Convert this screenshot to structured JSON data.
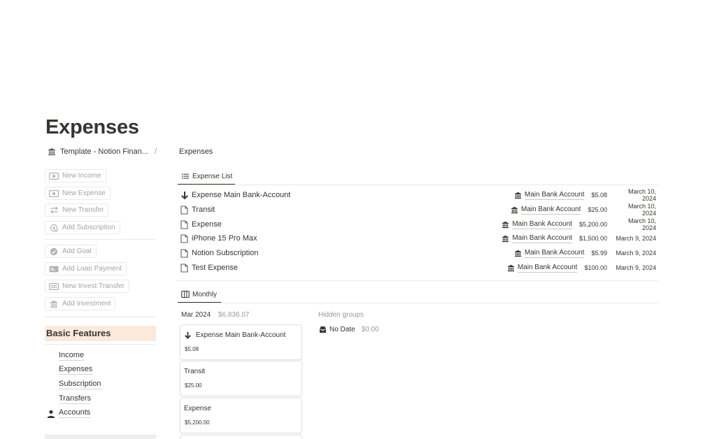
{
  "page": {
    "title": "Expenses"
  },
  "breadcrumb": {
    "parent": "Template - Notion Finan...",
    "separator": "/",
    "current": "Expenses"
  },
  "left_buttons": {
    "group1": [
      "New Income",
      "New Expense",
      "New Transfer",
      "Add Subscription"
    ],
    "group2": [
      "Add Goal",
      "Add Loan Payment",
      "New Invest Transfer",
      "Add Investment"
    ]
  },
  "basic_features": {
    "heading": "Basic Features",
    "links": [
      "Income",
      "Expenses",
      "Subscription",
      "Transfers",
      "Accounts"
    ]
  },
  "list_view": {
    "tab_label": "Expense List",
    "rows": [
      {
        "name": "Expense Main Bank-Account",
        "icon": "arrow-down-icon",
        "account": "Main Bank Account",
        "amount": "$5.08",
        "date": "March 10, 2024"
      },
      {
        "name": "Transit",
        "icon": "page-icon",
        "account": "Main Bank Account",
        "amount": "$25.00",
        "date": "March 10, 2024"
      },
      {
        "name": "Expense",
        "icon": "page-icon",
        "account": "Main Bank Account",
        "amount": "$5,200.00",
        "date": "March 10, 2024"
      },
      {
        "name": "iPhone 15 Pro Max",
        "icon": "page-icon",
        "account": "Main Bank Account",
        "amount": "$1,500.00",
        "date": "March 9, 2024"
      },
      {
        "name": "Notion Subscription",
        "icon": "page-icon",
        "account": "Main Bank Account",
        "amount": "$5.99",
        "date": "March 9, 2024"
      },
      {
        "name": "Test Expense",
        "icon": "page-icon",
        "account": "Main Bank Account",
        "amount": "$100.00",
        "date": "March 9, 2024"
      }
    ]
  },
  "board_view": {
    "tab_label": "Monthly",
    "group": {
      "title": "Mar 2024",
      "sum": "$6,836.07"
    },
    "hidden_groups_label": "Hidden groups",
    "no_date": {
      "label": "No Date",
      "sum": "$0.00"
    },
    "cards": [
      {
        "name": "Expense Main Bank-Account",
        "amount": "$5.08"
      },
      {
        "name": "Transit",
        "amount": "$25.00"
      },
      {
        "name": "Expense",
        "amount": "$5,200.00"
      }
    ]
  },
  "colors": {
    "text": "#37352f",
    "muted": "#9b9a97",
    "section_highlight": "#fbeadc",
    "border": "#e9e9e7"
  }
}
